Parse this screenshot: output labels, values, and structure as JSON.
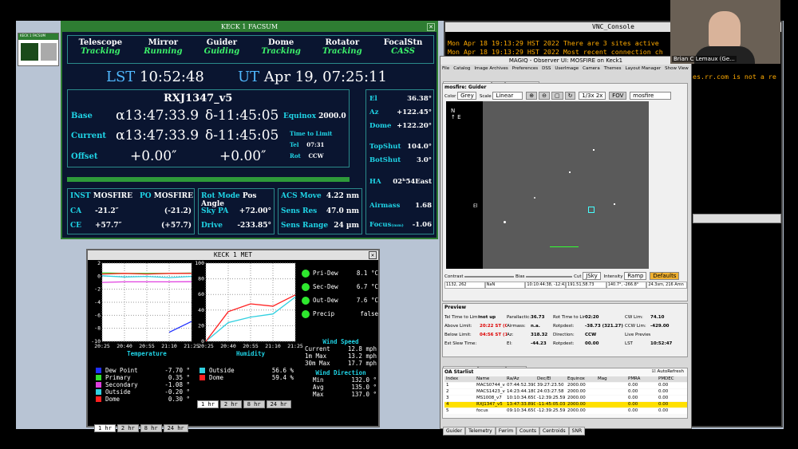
{
  "icon_window": {
    "label": "KECK 1 FACSUM"
  },
  "facsum": {
    "title": "KECK 1 FACSUM",
    "subsystems": [
      {
        "name": "Telescope",
        "status": "Tracking"
      },
      {
        "name": "Mirror",
        "status": "Running"
      },
      {
        "name": "Guider",
        "status": "Guiding"
      },
      {
        "name": "Dome",
        "status": "Tracking"
      },
      {
        "name": "Rotator",
        "status": "Tracking"
      },
      {
        "name": "FocalStn",
        "status": "CASS"
      }
    ],
    "lst_label": "LST",
    "lst": "10:52:48",
    "ut_label": "UT",
    "ut": "Apr 19, 07:25:11",
    "target": "RXJ1347_v5",
    "base_label": "Base",
    "base_ra": "α13:47:33.9",
    "base_dec": "δ-11:45:05",
    "current_label": "Current",
    "cur_ra": "α13:47:33.9",
    "cur_dec": "δ-11:45:05",
    "offset_label": "Offset",
    "off_ra": "+0.00″",
    "off_dec": "+0.00″",
    "equinox_label": "Equinox",
    "equinox": "2000.0",
    "ttl_label": "Time to Limit",
    "tel_label": "Tel",
    "tel": "07:31",
    "rot_label": "Rot",
    "rot": "CCW",
    "el_label": "El",
    "el": "36.38°",
    "az_label": "Az",
    "az": "+122.45°",
    "dome_label": "Dome",
    "dome": "+122.20°",
    "topshut_label": "TopShut",
    "topshut": "104.0°",
    "botshut_label": "BotShut",
    "botshut": "3.0°",
    "ha_label": "HA",
    "ha": "02ʰ54East",
    "airmass_label": "Airmass",
    "airmass": "1.68",
    "focus_label": "Focus",
    "focus_unit": "(mm)",
    "focus": "-1.06",
    "inst_label": "INST",
    "inst": "MOSFIRE",
    "po_label": "PO",
    "po": "MOSFIRE",
    "ca_label": "CA",
    "ca": "-21.2″",
    "ca2": "(-21.2)",
    "ce_label": "CE",
    "ce": "+57.7″",
    "ce2": "(+57.7)",
    "rotmode_label": "Rot Mode",
    "rotmode": "Pos Angle",
    "skypa_label": "Sky PA",
    "skypa": "+72.00°",
    "drive_label": "Drive",
    "drive": "-233.85°",
    "acsmove_label": "ACS Move",
    "acsmove": "4.22 nm",
    "sensres_label": "Sens Res",
    "sensres": "47.0 nm",
    "sensrange_label": "Sens Range",
    "sensrange": "24 µm"
  },
  "met": {
    "title": "KECK 1 MET",
    "temp_title": "Temperature",
    "hum_title": "Humidity",
    "temp_legend": [
      {
        "name": "Dew Point",
        "value": "-7.70 °",
        "color": "#2030ff"
      },
      {
        "name": "Primary",
        "value": "0.35 °",
        "color": "#30e030"
      },
      {
        "name": "Secondary",
        "value": "-1.08 °",
        "color": "#e040e0"
      },
      {
        "name": "Outside",
        "value": "-0.20 °",
        "color": "#30d0e0"
      },
      {
        "name": "Dome",
        "value": "0.30 °",
        "color": "#ff2020"
      }
    ],
    "hum_legend": [
      {
        "name": "Outside",
        "value": "56.6 %",
        "color": "#30d0e0"
      },
      {
        "name": "Dome",
        "value": "59.4 %",
        "color": "#ff2020"
      }
    ],
    "range_buttons": [
      "1 hr",
      "2 hr",
      "8 hr",
      "24 hr"
    ],
    "status": [
      {
        "label": "Pri-Dew",
        "value": "8.1 °C"
      },
      {
        "label": "Sec-Dew",
        "value": "6.7 °C"
      },
      {
        "label": "Out-Dew",
        "value": "7.6 °C"
      },
      {
        "label": "Precip",
        "value": "false"
      }
    ],
    "wind_speed_title": "Wind Speed",
    "wind_speed": [
      {
        "label": "Current",
        "value": "12.8 mph"
      },
      {
        "label": "1m Max",
        "value": "13.2 mph"
      },
      {
        "label": "30m Max",
        "value": "17.7 mph"
      }
    ],
    "wind_dir_title": "Wind Direction",
    "wind_dir": [
      {
        "label": "Min",
        "value": "132.0 °"
      },
      {
        "label": "Avg",
        "value": "135.0 °"
      },
      {
        "label": "Max",
        "value": "137.0 °"
      }
    ],
    "x_ticks": [
      "20:25",
      "20:40",
      "20:55",
      "21:10",
      "21:25"
    ],
    "temp_y": [
      "2",
      "0",
      "-2",
      "-4",
      "-6",
      "-8",
      "-10"
    ],
    "hum_y": [
      "100",
      "80",
      "60",
      "40",
      "20",
      "0"
    ]
  },
  "chart_data": [
    {
      "type": "line",
      "title": "Temperature",
      "x": [
        "20:25",
        "20:40",
        "20:55",
        "21:10",
        "21:25"
      ],
      "ylim": [
        -11,
        2
      ],
      "series": [
        {
          "name": "Primary",
          "values": [
            0.4,
            0.3,
            0.3,
            0.3,
            0.35
          ]
        },
        {
          "name": "Outside",
          "values": [
            -0.1,
            -0.3,
            -0.2,
            -0.4,
            -0.2
          ]
        },
        {
          "name": "Dome",
          "values": [
            0.2,
            0.3,
            0.2,
            0.3,
            0.3
          ]
        },
        {
          "name": "Secondary",
          "values": [
            -1.2,
            -1.1,
            -1.1,
            -1.1,
            -1.08
          ]
        },
        {
          "name": "Dew Point",
          "values": [
            null,
            null,
            null,
            -9.5,
            -7.7
          ]
        }
      ]
    },
    {
      "type": "line",
      "title": "Humidity",
      "x": [
        "20:25",
        "20:40",
        "20:55",
        "21:10",
        "21:25"
      ],
      "ylim": [
        0,
        100
      ],
      "series": [
        {
          "name": "Outside",
          "values": [
            0,
            24,
            31,
            35,
            56.6
          ]
        },
        {
          "name": "Dome",
          "values": [
            0,
            38,
            48,
            45,
            59.4
          ]
        }
      ]
    }
  ],
  "vnc": {
    "title": "VNC_Console",
    "line1": "Mon Apr 18 19:13:29 HST 2022 There are 3 sites active",
    "line2": "Mon Apr 18 19:13:29 HST 2022 Most recent connection ch",
    "frag": "es.rr.com is not a re"
  },
  "video": {
    "name": "Brian C Lemaux (Ge..."
  },
  "magiq": {
    "title": "MAGIQ - Observer UI: MOSFIRE on Keck1",
    "menu": [
      "File",
      "Catalog",
      "Image Archives",
      "Preferences",
      "DSS",
      "UserImage",
      "Camera",
      "Themes",
      "Layout Manager",
      "Show View"
    ],
    "tabs": [
      "mosfire: Guider",
      "Sta",
      "User Image"
    ],
    "panel_title": "mosfire: Guider",
    "color_label": "Color",
    "color_val": "Grey",
    "scale_label": "Scale",
    "scale_val": "Linear",
    "zoom_val": "1/3x 2x",
    "fov": "FOV",
    "cam": "mosfire",
    "contrast": "Contrast",
    "bias": "Bias",
    "cut_label": "Cut",
    "cut": "JSky",
    "intensity_label": "Intensity",
    "intensity": "Ramp",
    "defaults": "Defaults",
    "status_cells": [
      "1132, 262",
      "NaN",
      "10:10:44:38, -12:43:53.2",
      "191.51,58.73",
      "140.7°, -266.8°",
      "24.3sm, 216 Amn"
    ],
    "preview_title": "Preview",
    "pv": [
      [
        "Tel Time to Limit:",
        "not up",
        "Parallactic:",
        "36.73",
        "Rot Time to Limit:",
        "02:20",
        "CW Lim:",
        "74.10"
      ],
      [
        "Above Limit:",
        "20:22 ST (05:29)",
        "Airmass:",
        "n.a.",
        "Rotpdest:",
        "-38.73 (321.27)",
        "CCW Lim:",
        "-429.00"
      ],
      [
        "Below Limit:",
        "04:56 ST (10:63)",
        "Az:",
        "318.32",
        "Direction:",
        "CCW",
        "Live Preview",
        ""
      ],
      [
        "Est Slew Time:",
        "",
        "El:",
        "-44.23",
        "Rotpdest:",
        "00.00",
        "LST",
        "10:52:47"
      ]
    ],
    "oa_tabs": [
      "OA Starlist",
      "Catalogs",
      "Target"
    ],
    "oa_title": "OA Starlist",
    "autorefresh": "AutoRefresh",
    "cols": [
      "Index",
      "Name",
      "Ra/Az",
      "Dec/El",
      "Equinox",
      "Mag",
      "PMRA",
      "PMDEC"
    ],
    "rows": [
      [
        "1",
        "MACS0744_v4",
        "07:44:52.390",
        "39:27:23.50",
        "2000.00",
        "",
        "0.00",
        "0.00"
      ],
      [
        "2",
        "MACS1423_v5",
        "14:23:44.180",
        "24:03:27.58",
        "2000.00",
        "",
        "0.00",
        "0.00"
      ],
      [
        "3",
        "MS1008_v7",
        "10:10:34.650",
        "-12:39:25.59",
        "2000.00",
        "",
        "0.00",
        "0.00"
      ],
      [
        "4",
        "RXJ1347_v5",
        "13:47:33.890",
        "-11:45:05.03",
        "2000.00",
        "",
        "0.00",
        "0.00"
      ],
      [
        "5",
        "focus",
        "09:10:34.650",
        "-12:39:25.59",
        "2000.00",
        "",
        "0.00",
        "0.00"
      ]
    ],
    "bottom_tabs": [
      "Guider",
      "Telemetry",
      "Fwrim",
      "Counts",
      "Centroids",
      "SNR"
    ]
  }
}
